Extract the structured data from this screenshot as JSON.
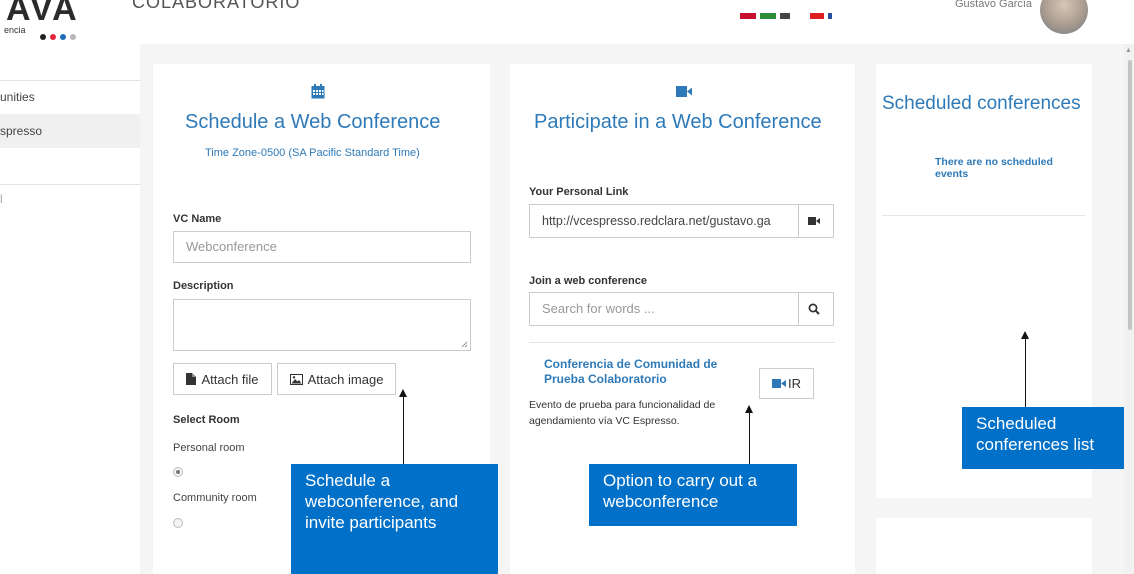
{
  "header": {
    "logo_text": "AVA",
    "logo_subtext": "encia",
    "app_title": "COLABORATORIO",
    "user_name": "Gustavo García"
  },
  "sidebar": {
    "items": [
      {
        "label": "unities"
      },
      {
        "label": "spresso"
      },
      {
        "label": "l"
      }
    ]
  },
  "schedule_panel": {
    "title": "Schedule a Web Conference",
    "timezone": "Time Zone-0500 (SA Pacific Standard Time)",
    "vc_name_label": "VC Name",
    "vc_name_placeholder": "Webconference",
    "description_label": "Description",
    "attach_file_label": "Attach file",
    "attach_image_label": "Attach image",
    "select_room_label": "Select Room",
    "personal_room_label": "Personal room",
    "community_room_label": "Community room",
    "selected_room": "Personal room"
  },
  "participate_panel": {
    "title": "Participate in a Web Conference",
    "personal_link_label": "Your Personal Link",
    "personal_link_value": "http://vcespresso.redclara.net/gustavo.ga",
    "join_label": "Join a web conference",
    "search_placeholder": "Search for words ...",
    "conference": {
      "title": "Conferencia de Comunidad de Prueba Colaboratorio",
      "description": "Evento de prueba para funcionalidad de agendamiento vía VC Espresso.",
      "join_button_label": "IR"
    }
  },
  "scheduled_panel": {
    "title": "Scheduled conferences",
    "empty_message": "There are no scheduled events"
  },
  "callouts": {
    "schedule": "Schedule a webconference, and invite participants",
    "carry_out": "Option to carry out a webconference",
    "list": "Scheduled conferences list"
  },
  "colors": {
    "accent_blue": "#2e7ab8",
    "callout_blue": "#0070c8"
  }
}
